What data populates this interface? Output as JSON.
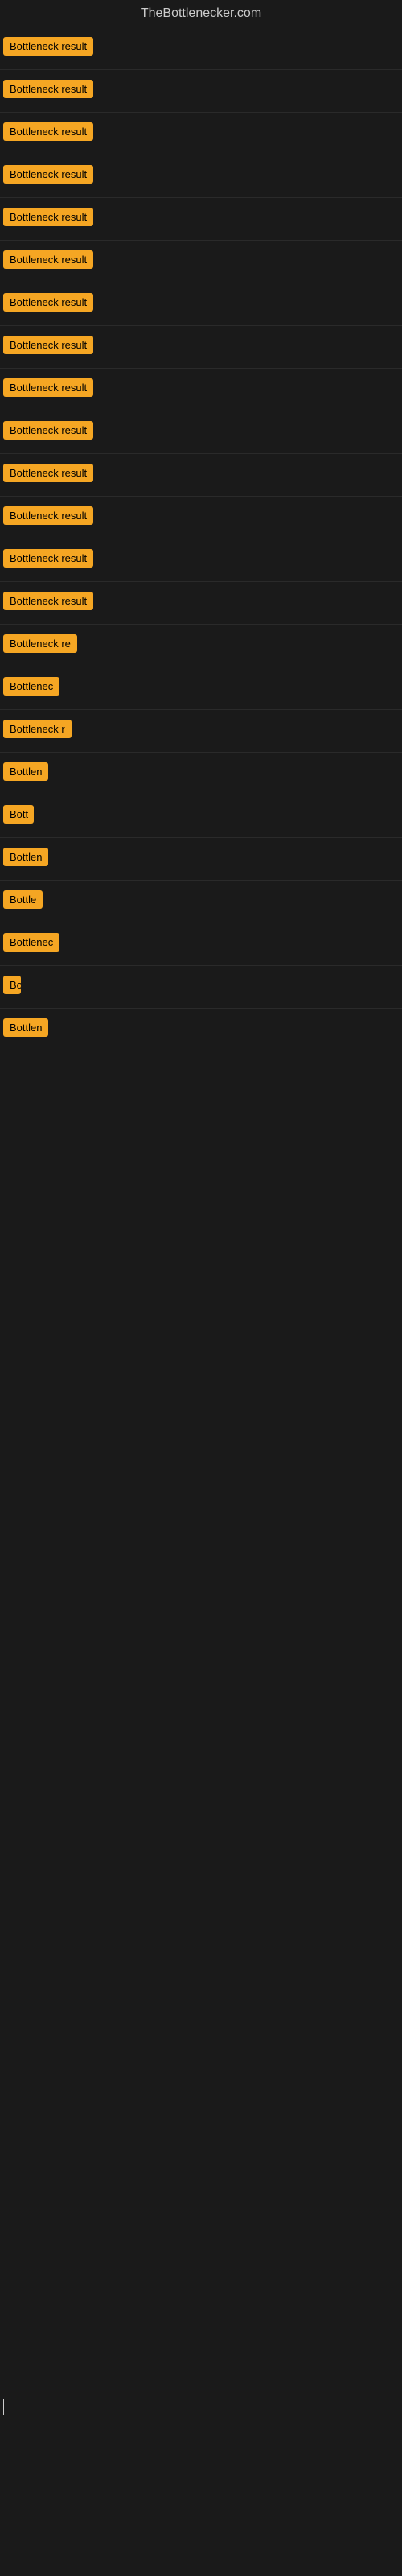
{
  "site": {
    "title": "TheBottlenecker.com"
  },
  "rows": [
    {
      "id": 1,
      "label": "Bottleneck result",
      "width": "full"
    },
    {
      "id": 2,
      "label": "Bottleneck result",
      "width": "full"
    },
    {
      "id": 3,
      "label": "Bottleneck result",
      "width": "full"
    },
    {
      "id": 4,
      "label": "Bottleneck result",
      "width": "full"
    },
    {
      "id": 5,
      "label": "Bottleneck result",
      "width": "full"
    },
    {
      "id": 6,
      "label": "Bottleneck result",
      "width": "full"
    },
    {
      "id": 7,
      "label": "Bottleneck result",
      "width": "full"
    },
    {
      "id": 8,
      "label": "Bottleneck result",
      "width": "full"
    },
    {
      "id": 9,
      "label": "Bottleneck result",
      "width": "full"
    },
    {
      "id": 10,
      "label": "Bottleneck result",
      "width": "full"
    },
    {
      "id": 11,
      "label": "Bottleneck result",
      "width": "full"
    },
    {
      "id": 12,
      "label": "Bottleneck result",
      "width": "full"
    },
    {
      "id": 13,
      "label": "Bottleneck result",
      "width": "full"
    },
    {
      "id": 14,
      "label": "Bottleneck result",
      "width": "full"
    },
    {
      "id": 15,
      "label": "Bottleneck re",
      "width": "partial-1"
    },
    {
      "id": 16,
      "label": "Bottlenec",
      "width": "partial-2"
    },
    {
      "id": 17,
      "label": "Bottleneck r",
      "width": "partial-3"
    },
    {
      "id": 18,
      "label": "Bottlen",
      "width": "partial-4"
    },
    {
      "id": 19,
      "label": "Bott",
      "width": "partial-5"
    },
    {
      "id": 20,
      "label": "Bottlen",
      "width": "partial-4"
    },
    {
      "id": 21,
      "label": "Bottle",
      "width": "partial-6"
    },
    {
      "id": 22,
      "label": "Bottlenec",
      "width": "partial-2"
    },
    {
      "id": 23,
      "label": "Bo",
      "width": "partial-7"
    },
    {
      "id": 24,
      "label": "Bottlen",
      "width": "partial-4"
    }
  ]
}
